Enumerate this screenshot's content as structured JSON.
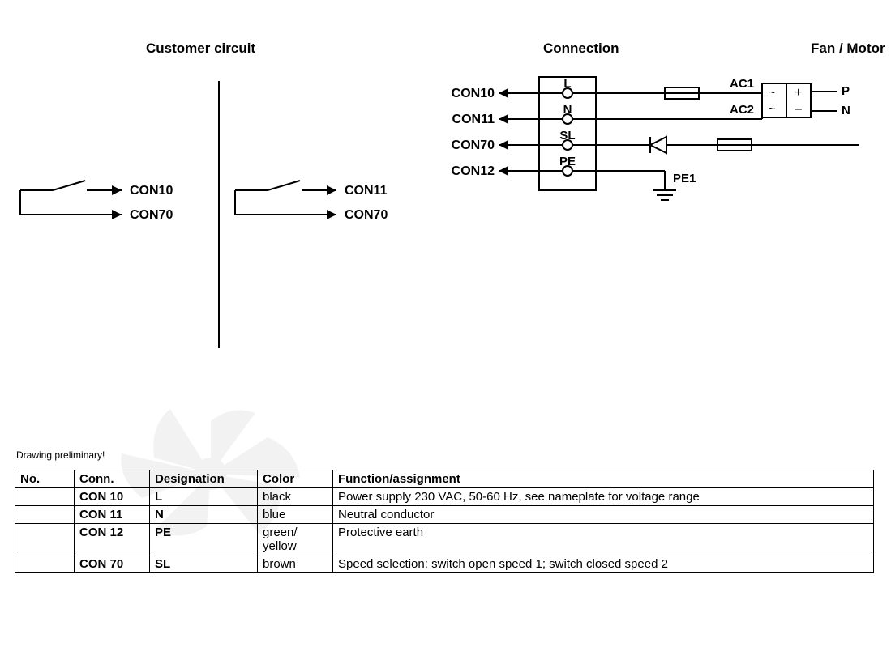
{
  "titles": {
    "customer": "Customer circuit",
    "connection": "Connection",
    "fan_motor": "Fan / Motor"
  },
  "left": {
    "sw1_top": "CON10",
    "sw1_bot": "CON70",
    "sw2_top": "CON11",
    "sw2_bot": "CON70"
  },
  "right": {
    "con10": "CON10",
    "con11": "CON11",
    "con70": "CON70",
    "con12": "CON12",
    "L": "L",
    "N": "N",
    "SL": "SL",
    "PE": "PE",
    "AC1": "AC1",
    "AC2": "AC2",
    "P": "P",
    "Nout": "N",
    "PE1": "PE1"
  },
  "caption": "Drawing preliminary!",
  "table": {
    "h1": "No.",
    "h2": "Conn.",
    "h3": "Designation",
    "h4": "Color",
    "h5": "Function/assignment",
    "r1": {
      "no": "",
      "conn": "CON 10",
      "desig": "L",
      "color": "black",
      "func": "Power supply 230 VAC, 50-60 Hz, see nameplate for voltage range"
    },
    "r2": {
      "no": "",
      "conn": "CON 11",
      "desig": "N",
      "color": "blue",
      "func": "Neutral conductor"
    },
    "r3": {
      "no": "",
      "conn": "CON 12",
      "desig": "PE",
      "color": "green/ yellow",
      "func": "Protective earth"
    },
    "r4": {
      "no": "",
      "conn": "CON 70",
      "desig": "SL",
      "color": "brown",
      "func": "Speed selection: switch open speed 1; switch closed speed 2"
    }
  }
}
